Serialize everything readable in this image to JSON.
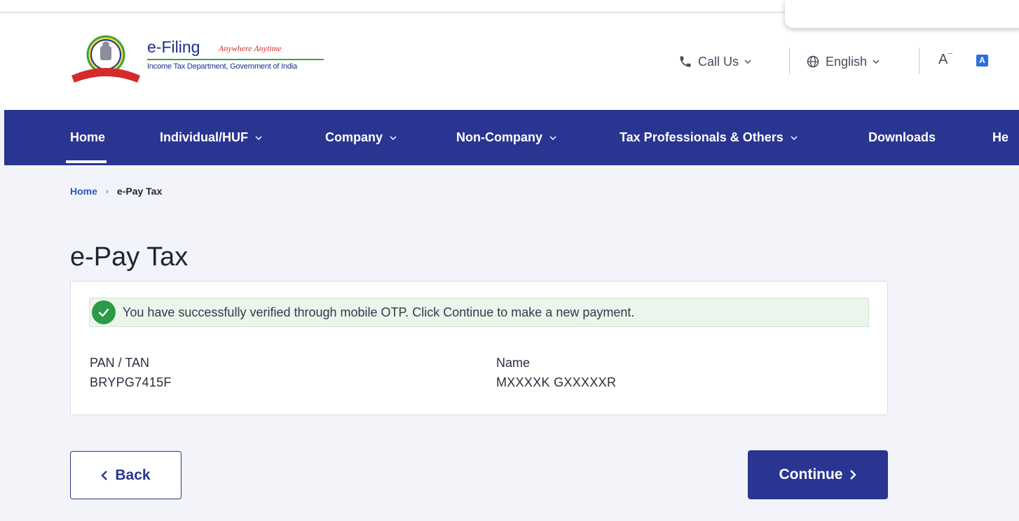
{
  "header": {
    "brand": {
      "title": "e-Filing",
      "tagline": "Anywhere Anytime",
      "subtitle": "Income Tax Department, Government of India"
    },
    "call_us": "Call Us",
    "language": "English",
    "font_size_label": "A",
    "contrast_label": "A"
  },
  "nav": {
    "items": [
      {
        "label": "Home",
        "active": true
      },
      {
        "label": "Individual/HUF",
        "dropdown": true
      },
      {
        "label": "Company",
        "dropdown": true
      },
      {
        "label": "Non-Company",
        "dropdown": true
      },
      {
        "label": "Tax Professionals & Others",
        "dropdown": true
      },
      {
        "label": "Downloads"
      },
      {
        "label": "He"
      }
    ]
  },
  "breadcrumb": {
    "home": "Home",
    "current": "e-Pay Tax"
  },
  "page": {
    "title": "e-Pay Tax"
  },
  "alert": {
    "message": "You have successfully verified through mobile OTP. Click Continue to make a new payment.",
    "status_color": "#2c9a46"
  },
  "details": {
    "pan_label": "PAN / TAN",
    "pan_value": "BRYPG7415F",
    "name_label": "Name",
    "name_value": "MXXXXK GXXXXXR"
  },
  "actions": {
    "back": "Back",
    "continue": "Continue"
  },
  "colors": {
    "primary": "#2a3591",
    "link": "#2a56c6",
    "success": "#2c9a46"
  }
}
